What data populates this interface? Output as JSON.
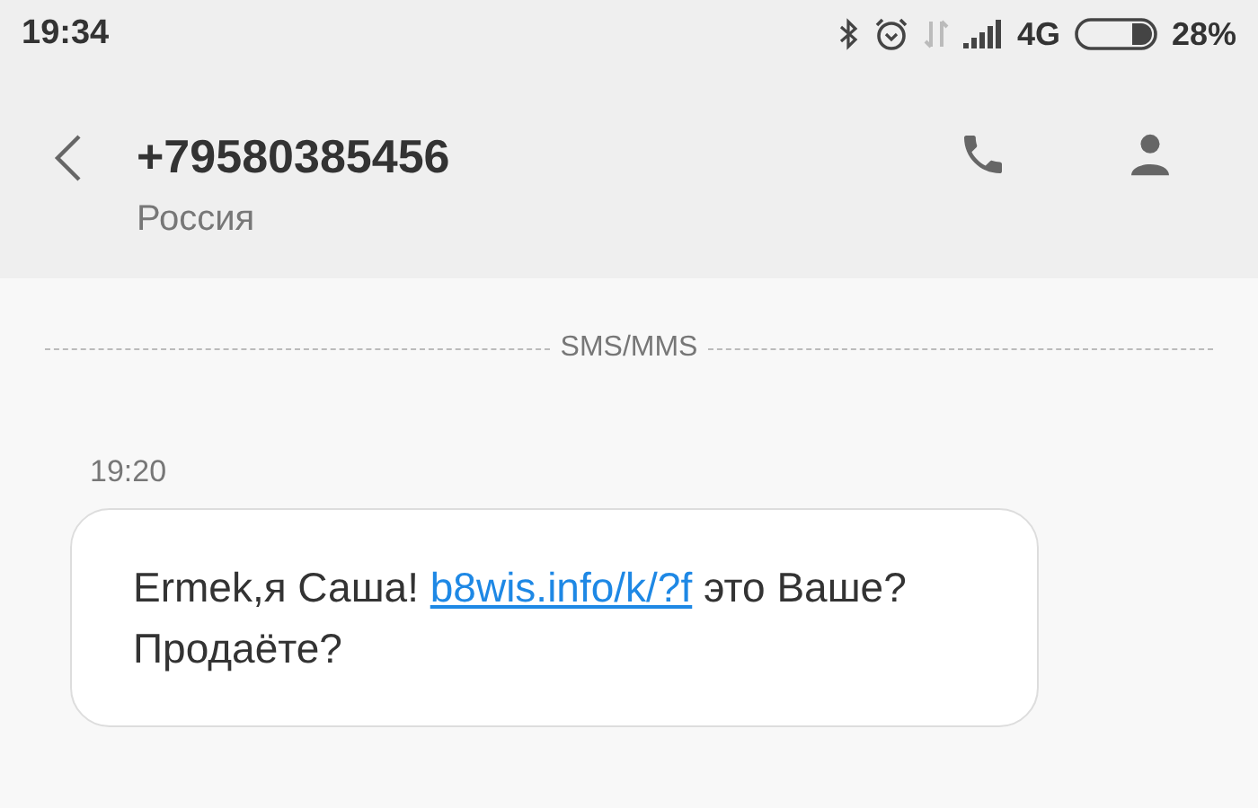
{
  "status_bar": {
    "time": "19:34",
    "network": "4G",
    "battery": "28%"
  },
  "header": {
    "phone": "+79580385456",
    "country": "Россия"
  },
  "divider_label": "SMS/MMS",
  "messages": [
    {
      "time": "19:20",
      "text_before": "Ermek,я Саша! ",
      "link": "b8wis.info/k/?f",
      "text_after": " это Ваше? Продаёте?"
    }
  ]
}
